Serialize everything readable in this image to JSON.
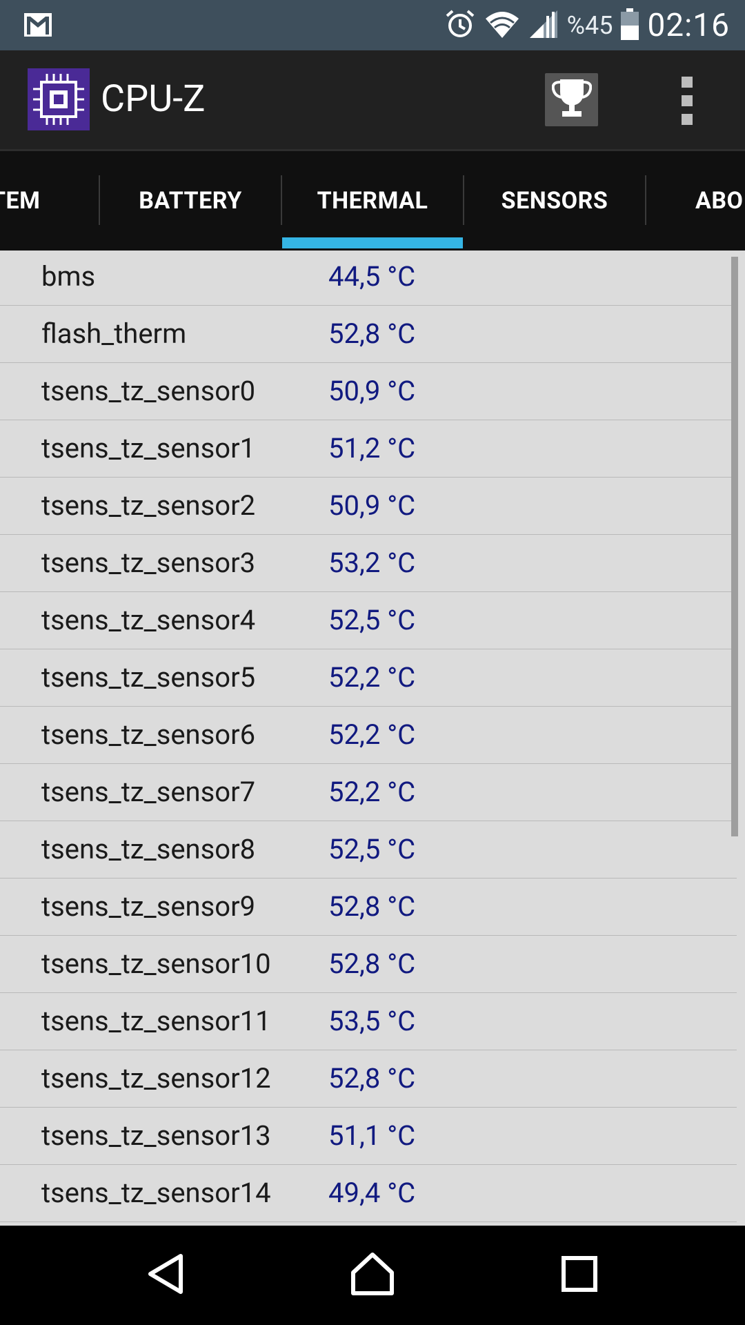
{
  "status_bar": {
    "battery_text": "%45",
    "time": "02:16",
    "icons": [
      "gmail-icon",
      "alarm-icon",
      "wifi-icon",
      "signal-icon",
      "battery-icon"
    ]
  },
  "action_bar": {
    "title": "CPU-Z",
    "icons": [
      "cpu-app-icon",
      "trophy-icon",
      "overflow-menu-icon"
    ]
  },
  "tabs": [
    {
      "label": "STEM"
    },
    {
      "label": "BATTERY"
    },
    {
      "label": "THERMAL",
      "selected": true
    },
    {
      "label": "SENSORS"
    },
    {
      "label": "ABO"
    }
  ],
  "accent_color": "#35b5e5",
  "value_color": "#111a80",
  "thermal": [
    {
      "name": "bms",
      "value": "44,5 °C"
    },
    {
      "name": "flash_therm",
      "value": "52,8 °C"
    },
    {
      "name": "tsens_tz_sensor0",
      "value": "50,9 °C"
    },
    {
      "name": "tsens_tz_sensor1",
      "value": "51,2 °C"
    },
    {
      "name": "tsens_tz_sensor2",
      "value": "50,9 °C"
    },
    {
      "name": "tsens_tz_sensor3",
      "value": "53,2 °C"
    },
    {
      "name": "tsens_tz_sensor4",
      "value": "52,5 °C"
    },
    {
      "name": "tsens_tz_sensor5",
      "value": "52,2 °C"
    },
    {
      "name": "tsens_tz_sensor6",
      "value": "52,2 °C"
    },
    {
      "name": "tsens_tz_sensor7",
      "value": "52,2 °C"
    },
    {
      "name": "tsens_tz_sensor8",
      "value": "52,5 °C"
    },
    {
      "name": "tsens_tz_sensor9",
      "value": "52,8 °C"
    },
    {
      "name": "tsens_tz_sensor10",
      "value": "52,8 °C"
    },
    {
      "name": "tsens_tz_sensor11",
      "value": "53,5 °C"
    },
    {
      "name": "tsens_tz_sensor12",
      "value": "52,8 °C"
    },
    {
      "name": "tsens_tz_sensor13",
      "value": "51,1 °C"
    },
    {
      "name": "tsens_tz_sensor14",
      "value": "49,4 °C"
    }
  ],
  "nav_bar": {
    "icons": [
      "back-icon",
      "home-icon",
      "recents-icon"
    ]
  }
}
